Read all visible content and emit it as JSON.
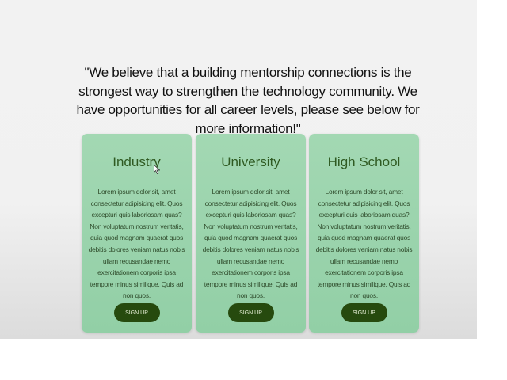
{
  "quote": "\"We believe that a building mentorship connections is the strongest way to strengthen the technology community. We have opportunities for all career levels, please see below for more information!\"",
  "cards": [
    {
      "title": "Industry",
      "body": "Lorem ipsum dolor sit, amet consectetur adipisicing elit. Quos excepturi quis laboriosam quas? Non voluptatum nostrum veritatis, quia quod magnam quaerat quos debitis dolores veniam natus nobis ullam recusandae nemo exercitationem corporis ipsa tempore minus similique. Quis ad non quos.",
      "button": "SIGN UP"
    },
    {
      "title": "University",
      "body": "Lorem ipsum dolor sit, amet consectetur adipisicing elit. Quos excepturi quis laboriosam quas? Non voluptatum nostrum veritatis, quia quod magnam quaerat quos debitis dolores veniam natus nobis ullam recusandae nemo exercitationem corporis ipsa tempore minus similique. Quis ad non quos.",
      "button": "SIGN UP"
    },
    {
      "title": "High School",
      "body": "Lorem ipsum dolor sit, amet consectetur adipisicing elit. Quos excepturi quis laboriosam quas? Non voluptatum nostrum veritatis, quia quod magnam quaerat quos debitis dolores veniam natus nobis ullam recusandae nemo exercitationem corporis ipsa tempore minus similique. Quis ad non quos.",
      "button": "SIGN UP"
    }
  ]
}
